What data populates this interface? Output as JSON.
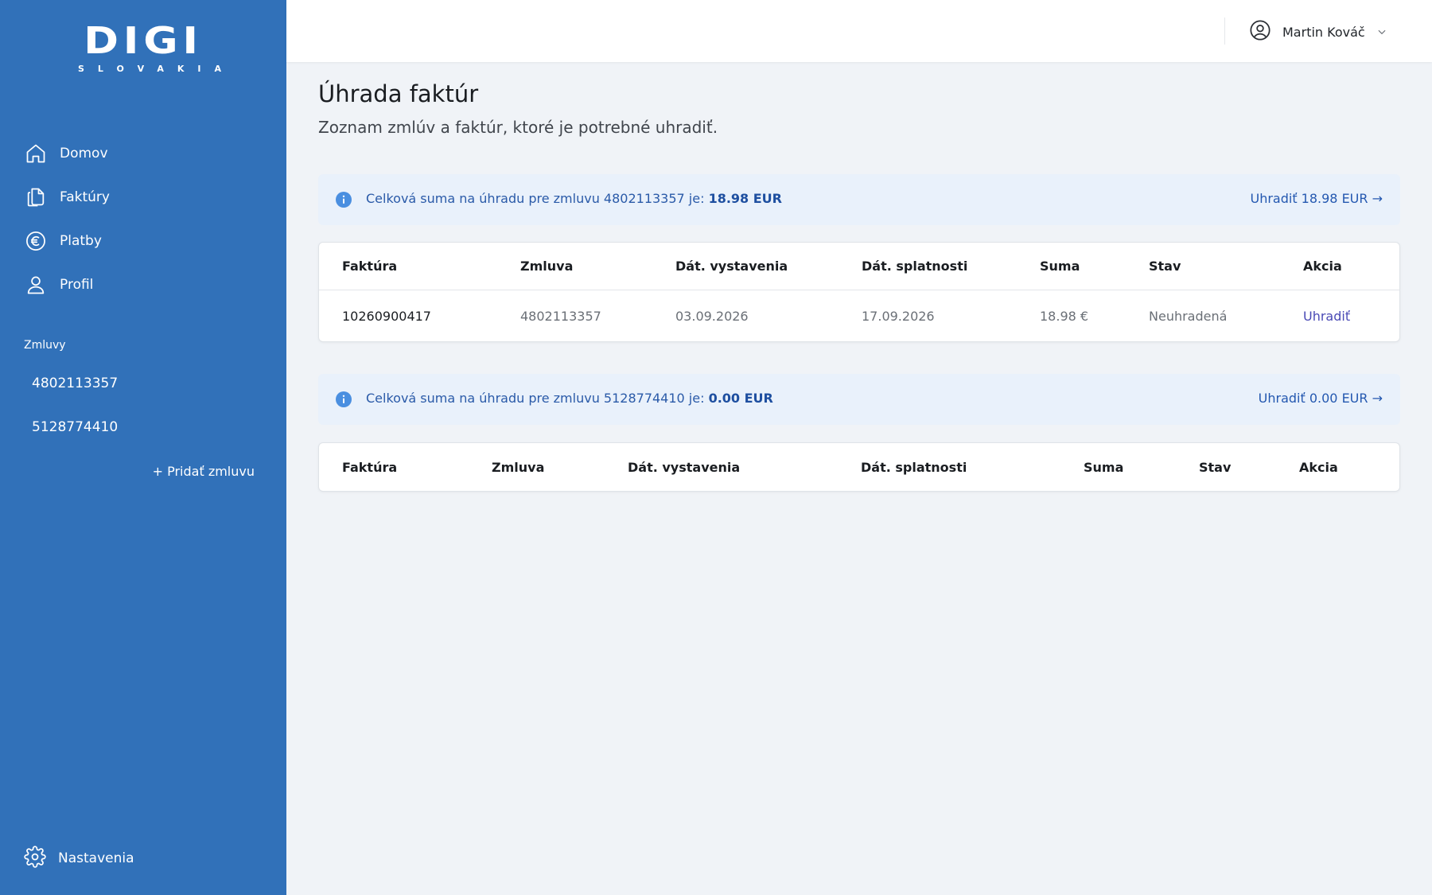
{
  "brand": {
    "logo_main": "DIGI",
    "logo_sub": "SLOVAKIA"
  },
  "sidebar": {
    "nav": [
      {
        "label": "Domov",
        "icon": "home-icon"
      },
      {
        "label": "Faktúry",
        "icon": "documents-icon"
      },
      {
        "label": "Platby",
        "icon": "euro-icon"
      },
      {
        "label": "Profil",
        "icon": "user-icon"
      }
    ],
    "contracts_title": "Zmluvy",
    "contracts": [
      "4802113357",
      "5128774410"
    ],
    "add_contract": "+ Pridať zmluvu",
    "settings": {
      "label": "Nastavenia",
      "icon": "gear-icon"
    }
  },
  "header": {
    "user_name": "Martin Kováč"
  },
  "page": {
    "title": "Úhrada faktúr",
    "subtitle": "Zoznam zmlúv a faktúr, ktoré je potrebné uhradiť."
  },
  "contracts": [
    {
      "notice_text": "Celková suma na úhradu pre zmluvu 4802113357 je: ",
      "notice_amount": "18.98 EUR",
      "pay_label": "Uhradiť 18.98 EUR →",
      "columns": [
        "Faktúra",
        "Zmluva",
        "Dát. vystavenia",
        "Dát. splatnosti",
        "Suma",
        "Stav",
        "Akcia"
      ],
      "rows": [
        {
          "invoice": "10260900417",
          "contract": "4802113357",
          "issued": "03.09.2026",
          "due": "17.09.2026",
          "amount": "18.98 €",
          "status": "Neuhradená",
          "action": "Uhradiť"
        }
      ]
    },
    {
      "notice_text": "Celková suma na úhradu pre zmluvu 5128774410 je: ",
      "notice_amount": "0.00 EUR",
      "pay_label": "Uhradiť 0.00 EUR →",
      "columns": [
        "Faktúra",
        "Zmluva",
        "Dát. vystavenia",
        "Dát. splatnosti",
        "Suma",
        "Stav",
        "Akcia"
      ],
      "rows": []
    }
  ],
  "colors": {
    "sidebar": "#3171b9",
    "page_bg": "#f0f3f7",
    "notice_bg": "#e9f1fb",
    "link": "#2458b0",
    "action": "#4a4ab5"
  }
}
